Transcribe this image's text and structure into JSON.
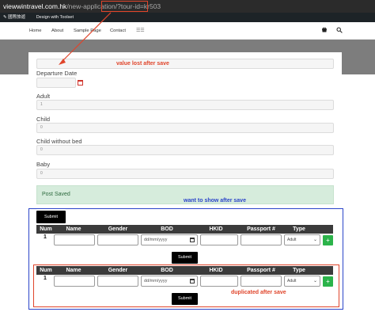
{
  "browser": {
    "host": "viewwintravel.com.hk",
    "path": "/new-application",
    "query": "/?tour-id=kr503"
  },
  "adminbar": {
    "site_label": "國際旅遊",
    "link_label": "Design with Toolset"
  },
  "nav": {
    "items": [
      "Home",
      "About",
      "Sample Page",
      "Contact"
    ],
    "more_label": "☰☰",
    "cart_icon": "cart-icon",
    "search_icon": "search-icon"
  },
  "form": {
    "fields": [
      {
        "label": "Departure Date",
        "value": ""
      },
      {
        "label": "Adult",
        "value": "1"
      },
      {
        "label": "Child",
        "value": "0"
      },
      {
        "label": "Child without bed",
        "value": "0"
      },
      {
        "label": "Baby",
        "value": "0"
      }
    ],
    "notice": "Post Saved"
  },
  "annotations": {
    "value_lost": "value lost after save",
    "want_to_show": "want to show after save",
    "duplicated": "duplicated after save"
  },
  "table": {
    "submit_label": "Submit",
    "headers": [
      "Num",
      "Name",
      "Gender",
      "BOD",
      "HKID",
      "Passport #",
      "Type"
    ],
    "rows": [
      {
        "num": "1",
        "bod_placeholder": "dd/mm/yyyy",
        "type": "Adult",
        "add": "+"
      },
      {
        "num": "1",
        "bod_placeholder": "dd/mm/yyyy",
        "type": "Adult",
        "add": "+"
      }
    ]
  },
  "colors": {
    "annotation_red": "#e0452b",
    "annotation_blue": "#2b45c9",
    "notice_green": "#d6ecdc",
    "add_button_green": "#2bb34a"
  }
}
